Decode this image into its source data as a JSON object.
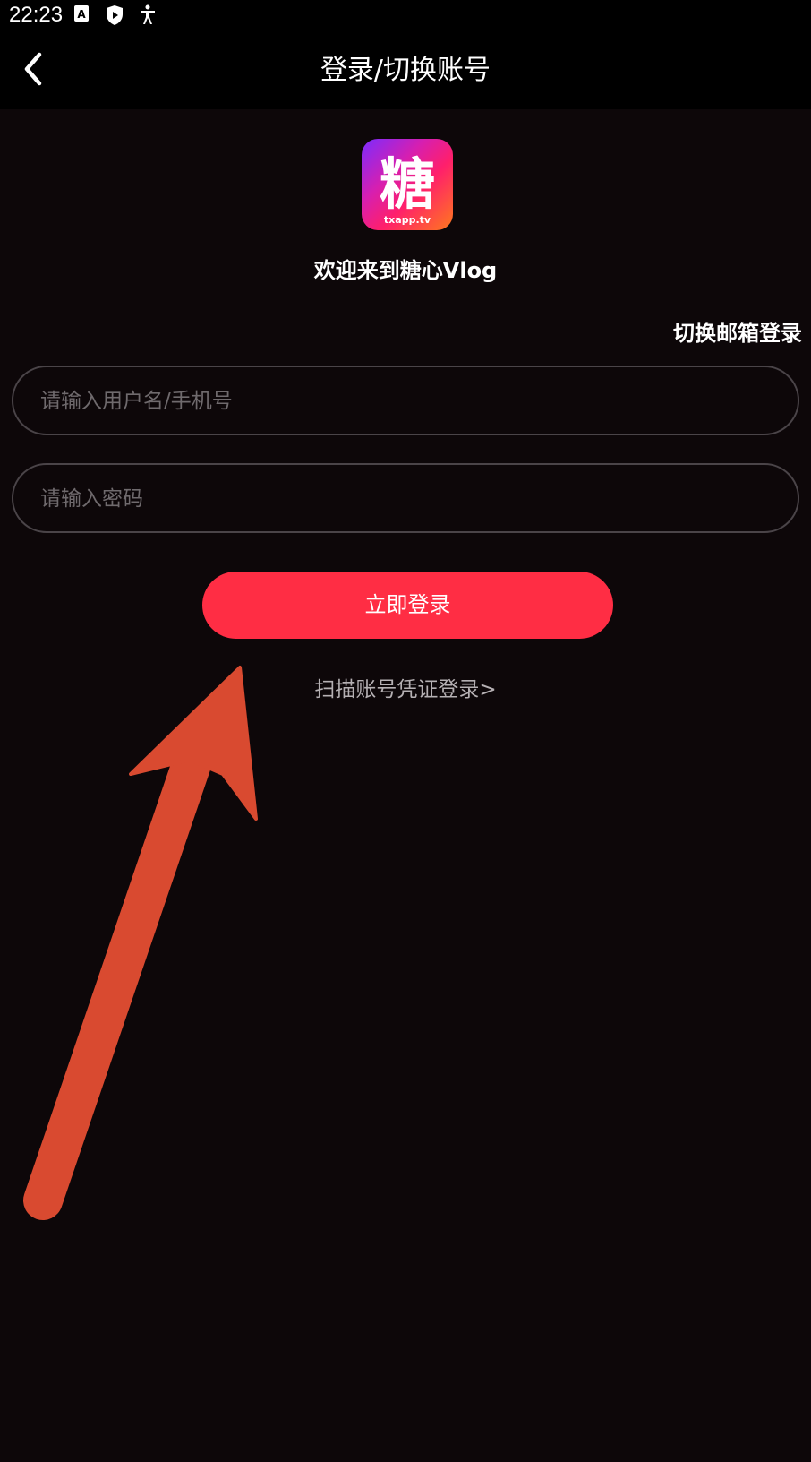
{
  "status_bar": {
    "time": "22:23",
    "icons": [
      "font-a-icon",
      "shield-play-icon",
      "accessibility-icon"
    ]
  },
  "header": {
    "title": "登录/切换账号",
    "back_icon": "chevron-left-icon"
  },
  "logo": {
    "glyph": "糖",
    "caption": "txapp.tv"
  },
  "welcome": "欢迎来到糖心Vlog",
  "switch_email_label": "切换邮箱登录",
  "username_field": {
    "placeholder": "请输入用户名/手机号",
    "value": ""
  },
  "password_field": {
    "placeholder": "请输入密码",
    "value": ""
  },
  "login_button_label": "立即登录",
  "scan_login_label": "扫描账号凭证登录>",
  "colors": {
    "background": "#0d0709",
    "primary_button": "#ff2d44",
    "arrow_annotation": "#d94a30"
  }
}
